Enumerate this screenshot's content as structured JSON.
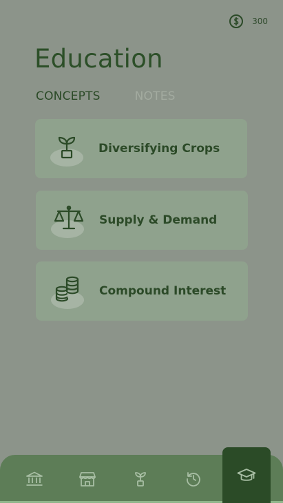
{
  "header": {
    "coin_icon": "dollar-circle-icon",
    "coin_balance": "300",
    "title": "Education"
  },
  "tabs": [
    {
      "label": "CONCEPTS",
      "active": true
    },
    {
      "label": "NOTES",
      "active": false
    }
  ],
  "concepts": [
    {
      "label": "Diversifying Crops",
      "icon": "sprout-pot-icon"
    },
    {
      "label": "Supply & Demand",
      "icon": "balance-scale-icon"
    },
    {
      "label": "Compound Interest",
      "icon": "coin-stack-icon"
    }
  ],
  "nav": [
    {
      "icon": "bank-icon",
      "active": false
    },
    {
      "icon": "store-icon",
      "active": false
    },
    {
      "icon": "sprout-icon",
      "active": false
    },
    {
      "icon": "history-icon",
      "active": false
    },
    {
      "icon": "graduation-cap-icon",
      "active": true
    }
  ],
  "colors": {
    "background": "#8c948a",
    "card": "#8fa28d",
    "text": "#2c4a28",
    "nav_bar": "#5d7d57",
    "nav_active": "#2b4b27",
    "nav_icon": "#a8bea4"
  }
}
